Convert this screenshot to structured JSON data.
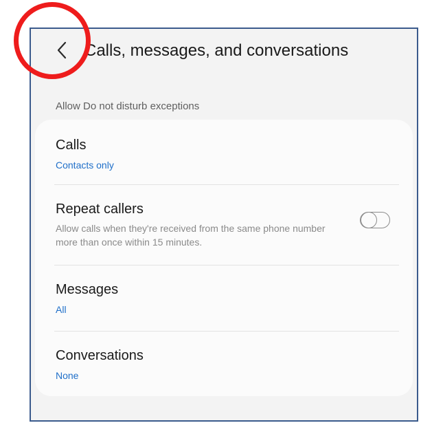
{
  "header": {
    "title": "Calls, messages, and conversations",
    "back_icon": "chevron-left-icon"
  },
  "section": {
    "label": "Allow Do not disturb exceptions"
  },
  "rows": [
    {
      "title": "Calls",
      "value": "Contacts only"
    },
    {
      "title": "Repeat callers",
      "description": "Allow calls when they're received from the same phone number more than once within 15 minutes.",
      "toggle_on": false
    },
    {
      "title": "Messages",
      "value": "All"
    },
    {
      "title": "Conversations",
      "value": "None"
    }
  ],
  "colors": {
    "accent": "#1f6fc9",
    "annotation": "#ee1c1c",
    "background": "#f3f3f3",
    "card": "#fbfbfb"
  }
}
